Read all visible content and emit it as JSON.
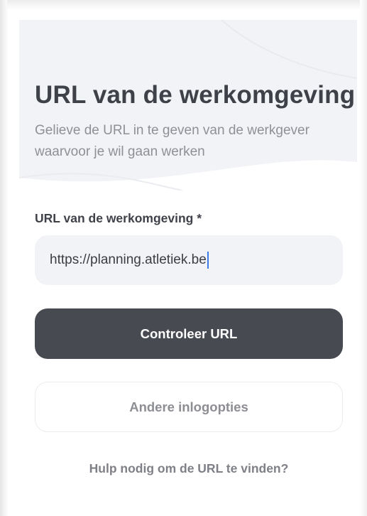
{
  "header": {
    "title": "URL van de werkomgeving",
    "subtitle": "Gelieve de URL in te geven van de werkgever waarvoor je wil gaan werken"
  },
  "form": {
    "url_label": "URL van de werkomgeving *",
    "url_value": "https://planning.atletiek.be"
  },
  "actions": {
    "check_url_label": "Controleer URL",
    "other_login_label": "Andere inlogopties",
    "help_link_label": "Hulp nodig om de URL te vinden?"
  },
  "colors": {
    "primary_button": "#484a52",
    "hero_background": "#f2f3f6",
    "caret": "#3b7be8",
    "title_text": "#3f4149",
    "muted_text": "#8f9096"
  }
}
